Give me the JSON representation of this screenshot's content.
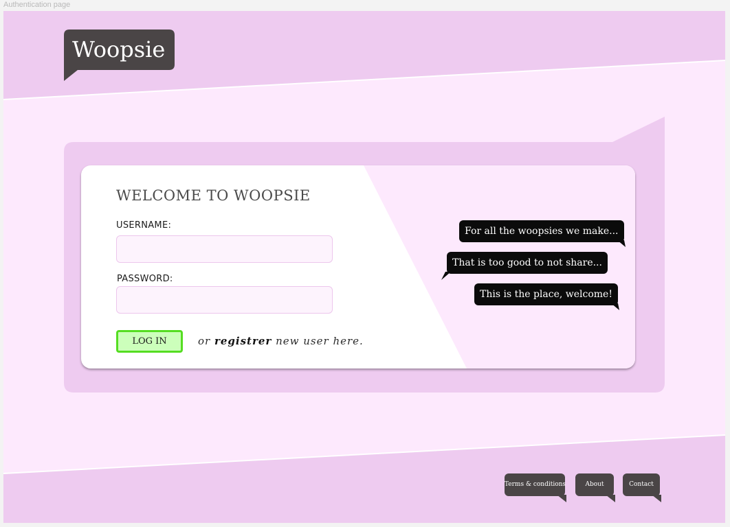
{
  "frame_label": "Authentication page",
  "logo": {
    "text": "Woopsie"
  },
  "login": {
    "title": "WELCOME TO WOOPSIE",
    "username_label": "USERNAME:",
    "username_value": "",
    "password_label": "PASSWORD:",
    "password_value": "",
    "login_button": "LOG IN",
    "register_prefix": "or",
    "register_link": "registrer",
    "register_suffix": "new user here."
  },
  "bubbles": [
    {
      "text": "For all the woopsies we make..."
    },
    {
      "text": "That is too good to not share..."
    },
    {
      "text": "This is the place, welcome!"
    }
  ],
  "footer": {
    "links": [
      {
        "label": "Terms & conditions"
      },
      {
        "label": "About"
      },
      {
        "label": "Contact"
      }
    ]
  },
  "colors": {
    "band": "#eecbf0",
    "page_bg": "#fde9fd",
    "card_bg": "#ffffff",
    "bubble_bg": "#0b0b0b",
    "button_border": "#55dd22",
    "button_bg": "#ccffbb",
    "footer_btn": "#4a4546"
  }
}
